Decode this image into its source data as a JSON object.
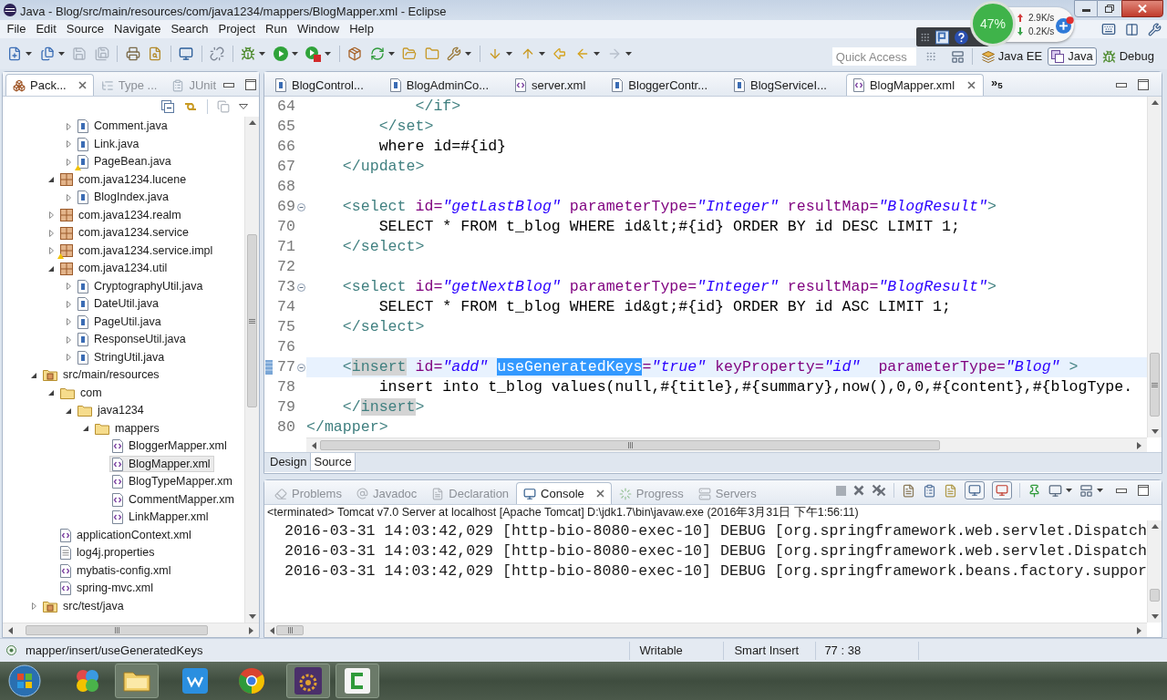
{
  "window": {
    "title": "Java - Blog/src/main/resources/com/java1234/mappers/BlogMapper.xml - Eclipse"
  },
  "menu": [
    "File",
    "Edit",
    "Source",
    "Navigate",
    "Search",
    "Project",
    "Run",
    "Window",
    "Help"
  ],
  "quick_access": {
    "placeholder": "Quick Access"
  },
  "perspectives": [
    {
      "label": "Java EE",
      "kind": "javaee",
      "selected": false
    },
    {
      "label": "Java",
      "kind": "java",
      "selected": true
    },
    {
      "label": "Debug",
      "kind": "debug",
      "selected": false
    }
  ],
  "system_monitor": {
    "cpu": "47%",
    "upload": "2.9K/s",
    "download": "0.2K/s"
  },
  "package_explorer": {
    "tabs": [
      {
        "label": "Pack...",
        "kind": "package",
        "selected": true
      },
      {
        "label": "Type ...",
        "kind": "hierarchy",
        "selected": false
      },
      {
        "label": "JUnit",
        "kind": "junit",
        "selected": false
      }
    ],
    "tree": [
      {
        "children": [
          {
            "children": [
              {
                "label": "Comment.java",
                "kind": "java",
                "expanded": false,
                "warning": false,
                "selected": false
              },
              {
                "label": "Link.java",
                "kind": "java",
                "expanded": false,
                "warning": false,
                "selected": false
              },
              {
                "label": "PageBean.java",
                "kind": "java",
                "expanded": false,
                "warning": true,
                "selected": false
              }
            ]
          },
          {
            "label": "com.java1234.lucene",
            "kind": "package",
            "expanded": true,
            "warning": false,
            "selected": false,
            "children": [
              {
                "label": "BlogIndex.java",
                "kind": "java",
                "expanded": false,
                "warning": false,
                "selected": false
              }
            ]
          },
          {
            "label": "com.java1234.realm",
            "kind": "package",
            "expanded": false,
            "warning": false,
            "selected": false
          },
          {
            "label": "com.java1234.service",
            "kind": "package",
            "expanded": false,
            "warning": false,
            "selected": false
          },
          {
            "label": "com.java1234.service.impl",
            "kind": "package",
            "expanded": false,
            "warning": true,
            "selected": false
          },
          {
            "label": "com.java1234.util",
            "kind": "package",
            "expanded": true,
            "warning": false,
            "selected": false,
            "children": [
              {
                "label": "CryptographyUtil.java",
                "kind": "java",
                "expanded": false,
                "warning": false,
                "selected": false
              },
              {
                "label": "DateUtil.java",
                "kind": "java",
                "expanded": false,
                "warning": false,
                "selected": false
              },
              {
                "label": "PageUtil.java",
                "kind": "java",
                "expanded": false,
                "warning": false,
                "selected": false
              },
              {
                "label": "ResponseUtil.java",
                "kind": "java",
                "expanded": false,
                "warning": false,
                "selected": false
              },
              {
                "label": "StringUtil.java",
                "kind": "java",
                "expanded": false,
                "warning": false,
                "selected": false
              }
            ]
          }
        ]
      },
      {
        "label": "src/main/resources",
        "kind": "source-folder",
        "expanded": true,
        "warning": false,
        "selected": false,
        "children": [
          {
            "label": "com",
            "kind": "folder",
            "expanded": true,
            "warning": false,
            "selected": false,
            "children": [
              {
                "label": "java1234",
                "kind": "folder",
                "expanded": true,
                "warning": false,
                "selected": false,
                "children": [
                  {
                    "label": "mappers",
                    "kind": "folder",
                    "expanded": true,
                    "warning": false,
                    "selected": false,
                    "children": [
                      {
                        "label": "BloggerMapper.xml",
                        "kind": "xml",
                        "warning": false,
                        "selected": false
                      },
                      {
                        "label": "BlogMapper.xml",
                        "kind": "xml",
                        "warning": false,
                        "selected": true
                      },
                      {
                        "label": "BlogTypeMapper.xm",
                        "kind": "xml",
                        "warning": false,
                        "selected": false
                      },
                      {
                        "label": "CommentMapper.xm",
                        "kind": "xml",
                        "warning": false,
                        "selected": false
                      },
                      {
                        "label": "LinkMapper.xml",
                        "kind": "xml",
                        "warning": false,
                        "selected": false
                      }
                    ]
                  }
                ]
              }
            ]
          },
          {
            "label": "applicationContext.xml",
            "kind": "xml",
            "warning": false,
            "selected": false
          },
          {
            "label": "log4j.properties",
            "kind": "properties",
            "warning": false,
            "selected": false
          },
          {
            "label": "mybatis-config.xml",
            "kind": "xml",
            "warning": false,
            "selected": false
          },
          {
            "label": "spring-mvc.xml",
            "kind": "xml",
            "warning": false,
            "selected": false
          }
        ]
      },
      {
        "label": "src/test/java",
        "kind": "source-folder",
        "expanded": false,
        "warning": false,
        "selected": false
      }
    ]
  },
  "editor": {
    "tabs": [
      {
        "label": "BlogControl...",
        "kind": "java",
        "selected": false
      },
      {
        "label": "BlogAdminCo...",
        "kind": "java",
        "selected": false
      },
      {
        "label": "server.xml",
        "kind": "xml",
        "selected": false
      },
      {
        "label": "BloggerContr...",
        "kind": "java",
        "selected": false
      },
      {
        "label": "BlogServiceI...",
        "kind": "java",
        "selected": false
      },
      {
        "label": "BlogMapper.xml",
        "kind": "xml",
        "selected": true
      }
    ],
    "more_tabs": "»$_{5}$",
    "lines": [
      {
        "number": "64",
        "current": false,
        "fold": false,
        "tokens": [
          {
            "kind": "tag",
            "text": "            </if>"
          }
        ]
      },
      {
        "number": "65",
        "current": false,
        "fold": false,
        "tokens": [
          {
            "kind": "tag",
            "text": "        </set>"
          }
        ]
      },
      {
        "number": "66",
        "current": false,
        "fold": false,
        "tokens": [
          {
            "kind": "text",
            "text": "        where id=#{id}"
          }
        ]
      },
      {
        "number": "67",
        "current": false,
        "fold": false,
        "tokens": [
          {
            "kind": "tag",
            "text": "    </update>"
          }
        ]
      },
      {
        "number": "68",
        "current": false,
        "fold": false
      },
      {
        "number": "69",
        "current": false,
        "fold": true,
        "tokens": [
          {
            "kind": "tag",
            "text": "    <select"
          },
          {
            "kind": "attr",
            "text": " id="
          },
          {
            "kind": "value",
            "text": "\"getLastBlog\""
          },
          {
            "kind": "attr",
            "text": " parameterType="
          },
          {
            "kind": "value",
            "text": "\"Integer\""
          },
          {
            "kind": "attr",
            "text": " resultMap="
          },
          {
            "kind": "value",
            "text": "\"BlogResult\""
          },
          {
            "kind": "tag",
            "text": ">"
          }
        ]
      },
      {
        "number": "70",
        "current": false,
        "fold": false,
        "tokens": [
          {
            "kind": "text",
            "text": "        SELECT * FROM t_blog WHERE id&lt;#{id} ORDER BY id DESC LIMIT 1;"
          }
        ]
      },
      {
        "number": "71",
        "current": false,
        "fold": false,
        "tokens": [
          {
            "kind": "tag",
            "text": "    </select>"
          }
        ]
      },
      {
        "number": "72",
        "current": false,
        "fold": false
      },
      {
        "number": "73",
        "current": false,
        "fold": true,
        "tokens": [
          {
            "kind": "tag",
            "text": "    <select"
          },
          {
            "kind": "attr",
            "text": " id="
          },
          {
            "kind": "value",
            "text": "\"getNextBlog\""
          },
          {
            "kind": "attr",
            "text": " parameterType="
          },
          {
            "kind": "value",
            "text": "\"Integer\""
          },
          {
            "kind": "attr",
            "text": " resultMap="
          },
          {
            "kind": "value",
            "text": "\"BlogResult\""
          },
          {
            "kind": "tag",
            "text": ">"
          }
        ]
      },
      {
        "number": "74",
        "current": false,
        "fold": false,
        "tokens": [
          {
            "kind": "text",
            "text": "        SELECT * FROM t_blog WHERE id&gt;#{id} ORDER BY id ASC LIMIT 1;"
          }
        ]
      },
      {
        "number": "75",
        "current": false,
        "fold": false,
        "tokens": [
          {
            "kind": "tag",
            "text": "    </select>"
          }
        ]
      },
      {
        "number": "76",
        "current": false,
        "fold": false
      },
      {
        "number": "77",
        "current": true,
        "fold": true,
        "tokens": [
          {
            "kind": "tag",
            "text": "    <"
          },
          {
            "kind": "tag",
            "text": "insert",
            "marked": true
          },
          {
            "kind": "attr",
            "text": " id="
          },
          {
            "kind": "value",
            "text": "\"add\" "
          },
          {
            "kind": "attr",
            "text": "useGeneratedKeys",
            "selected": true
          },
          {
            "kind": "attr",
            "text": "="
          },
          {
            "kind": "value",
            "text": "\"true\""
          },
          {
            "kind": "attr",
            "text": " keyProperty="
          },
          {
            "kind": "value",
            "text": "\"id\""
          },
          {
            "kind": "attr",
            "text": "  parameterType="
          },
          {
            "kind": "value",
            "text": "\"Blog\""
          },
          {
            "kind": "tag",
            "text": " >"
          }
        ]
      },
      {
        "number": "78",
        "current": false,
        "fold": false,
        "tokens": [
          {
            "kind": "text",
            "text": "        insert into t_blog values(null,#{title},#{summary},now(),0,0,#{content},#{blogType."
          }
        ]
      },
      {
        "number": "79",
        "current": false,
        "fold": false,
        "tokens": [
          {
            "kind": "tag",
            "text": "    </"
          },
          {
            "kind": "tag",
            "text": "insert",
            "marked": true
          },
          {
            "kind": "tag",
            "text": ">"
          }
        ]
      },
      {
        "number": "80",
        "current": false,
        "fold": false,
        "tokens": [
          {
            "kind": "tag",
            "text": "</mapper>"
          }
        ]
      }
    ],
    "bottom_tabs": [
      {
        "label": "Design",
        "selected": false
      },
      {
        "label": "Source",
        "selected": true
      }
    ]
  },
  "console": {
    "tabs": [
      {
        "label": "Problems",
        "kind": "problems",
        "selected": false
      },
      {
        "label": "Javadoc",
        "kind": "javadoc",
        "selected": false
      },
      {
        "label": "Declaration",
        "kind": "declaration",
        "selected": false
      },
      {
        "label": "Console",
        "kind": "console",
        "selected": true
      },
      {
        "label": "Progress",
        "kind": "progress",
        "selected": false
      },
      {
        "label": "Servers",
        "kind": "servers",
        "selected": false
      }
    ],
    "description": "<terminated> Tomcat v7.0 Server at localhost [Apache Tomcat] D:\\jdk1.7\\bin\\javaw.exe (2016年3月31日 下午1:56:11)",
    "lines": [
      "2016-03-31 14:03:42,029 [http-bio-8080-exec-10] DEBUG [org.springframework.web.servlet.Dispatch",
      "2016-03-31 14:03:42,029 [http-bio-8080-exec-10] DEBUG [org.springframework.web.servlet.Dispatch",
      "2016-03-31 14:03:42,029 [http-bio-8080-exec-10] DEBUG [org.springframework.beans.factory.suppor"
    ]
  },
  "status_bar": {
    "path": "mapper/insert/useGeneratedKeys",
    "mode": "Writable",
    "insert_mode": "Smart Insert",
    "position": "77 : 38"
  }
}
